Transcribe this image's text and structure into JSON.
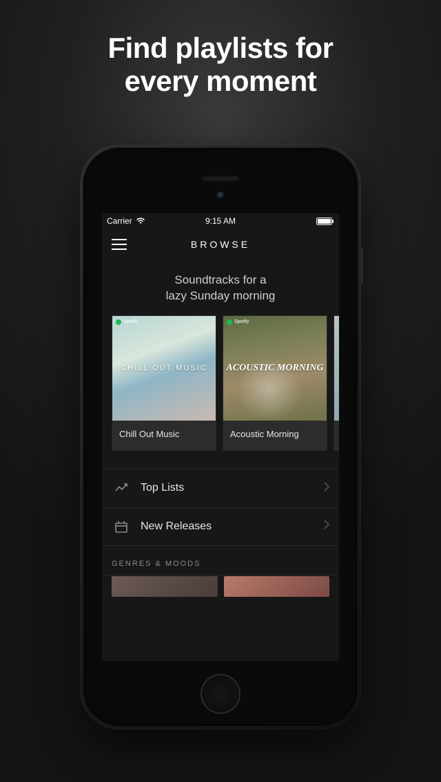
{
  "promo": {
    "headline_line1": "Find playlists for",
    "headline_line2": "every moment"
  },
  "status": {
    "carrier": "Carrier",
    "time": "9:15 AM"
  },
  "nav": {
    "title": "BROWSE"
  },
  "hero": {
    "line1": "Soundtracks for a",
    "line2": "lazy Sunday morning"
  },
  "playlists": [
    {
      "title": "Chill Out Music",
      "art_label": "CHILL OUT MUSIC",
      "badge": "Spotify"
    },
    {
      "title": "Acoustic Morning",
      "art_label": "ACOUSTIC MORNING",
      "badge": "Spotify"
    }
  ],
  "menu": [
    {
      "label": "Top Lists",
      "icon": "chart"
    },
    {
      "label": "New Releases",
      "icon": "calendar"
    }
  ],
  "section_label": "GENRES & MOODS"
}
